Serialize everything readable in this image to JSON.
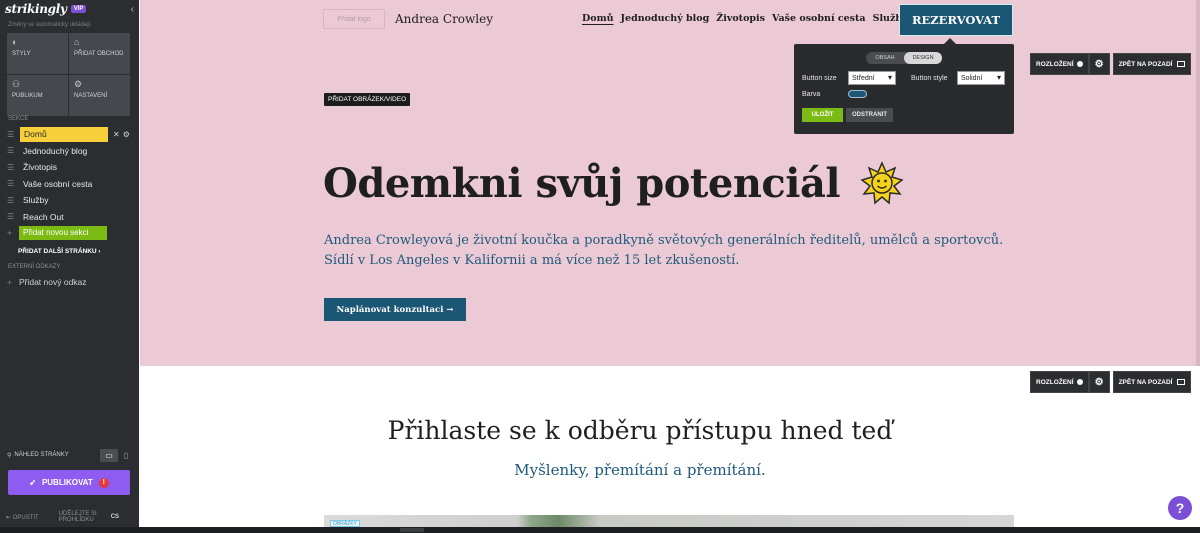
{
  "sidebar": {
    "logo": "strikingly",
    "vip_badge": "VIP",
    "note": "Změny se automaticky ukládají.",
    "tiles": [
      {
        "label": "STYLY",
        "icon": "palette-icon"
      },
      {
        "label": "PŘIDAT OBCHOD",
        "icon": "store-icon"
      },
      {
        "label": "PUBLIKUM",
        "icon": "people-icon"
      },
      {
        "label": "NASTAVENÍ",
        "icon": "gear-icon"
      }
    ],
    "sections_label": "SEKCE",
    "sections": [
      {
        "label": "Domů"
      },
      {
        "label": "Jednoduchý blog"
      },
      {
        "label": "Životopis"
      },
      {
        "label": "Vaše osobní cesta"
      },
      {
        "label": "Služby"
      },
      {
        "label": "Reach Out"
      }
    ],
    "add_section": "Přidat novou sekci",
    "add_page": "PŘIDAT DALŠÍ STRÁNKU",
    "external_links_label": "EXTERNÍ ODKAZY",
    "add_link": "Přidat nový odkaz",
    "preview_label": "NÁHLED STRÁNKY",
    "publish": "PUBLIKOVAT",
    "footer": {
      "exit": "OPUSTIT",
      "tips": "UDĚLEJTE SI PROHLÍDKU",
      "lang": "CS"
    }
  },
  "site": {
    "logo_placeholder": "Přidat logo",
    "title": "Andrea Crowley",
    "nav": [
      "Domů",
      "Jednoduchý blog",
      "Životopis",
      "Vaše osobní cesta",
      "Služby"
    ],
    "book_button": "REZERVOVAT"
  },
  "button_popup": {
    "tab_content": "OBSAH",
    "tab_design": "DESIGN",
    "size_label": "Button size",
    "size_value": "Střední",
    "style_label": "Button style",
    "style_value": "Solidní",
    "color_label": "Barva",
    "color": "#1b5674",
    "save": "ULOŽIT",
    "remove": "ODSTRANIT"
  },
  "section_tools": {
    "layout": "ROZLOŽENÍ",
    "background": "ZPĚT NA POZADÍ"
  },
  "hero": {
    "add_media": "PŘIDAT OBRÁZEK/VIDEO",
    "title": "Odemkni svůj potenciál",
    "subtitle_line1": "Andrea Crowleyová je životní koučka a poradkyně světových generálních ředitelů, umělců a sportovců.",
    "subtitle_line2": "Sídlí v Los Angeles v Kalifornii a má více než 15 let zkušeností.",
    "cta": "Naplánovat konzultaci →",
    "background": "#ebcad5"
  },
  "subscribe": {
    "title": "Přihlaste se k odběru přístupu hned teď",
    "subtitle": "Myšlenky, přemítání a přemítání.",
    "image_tag": "OBRÁZKY"
  },
  "help": "?"
}
